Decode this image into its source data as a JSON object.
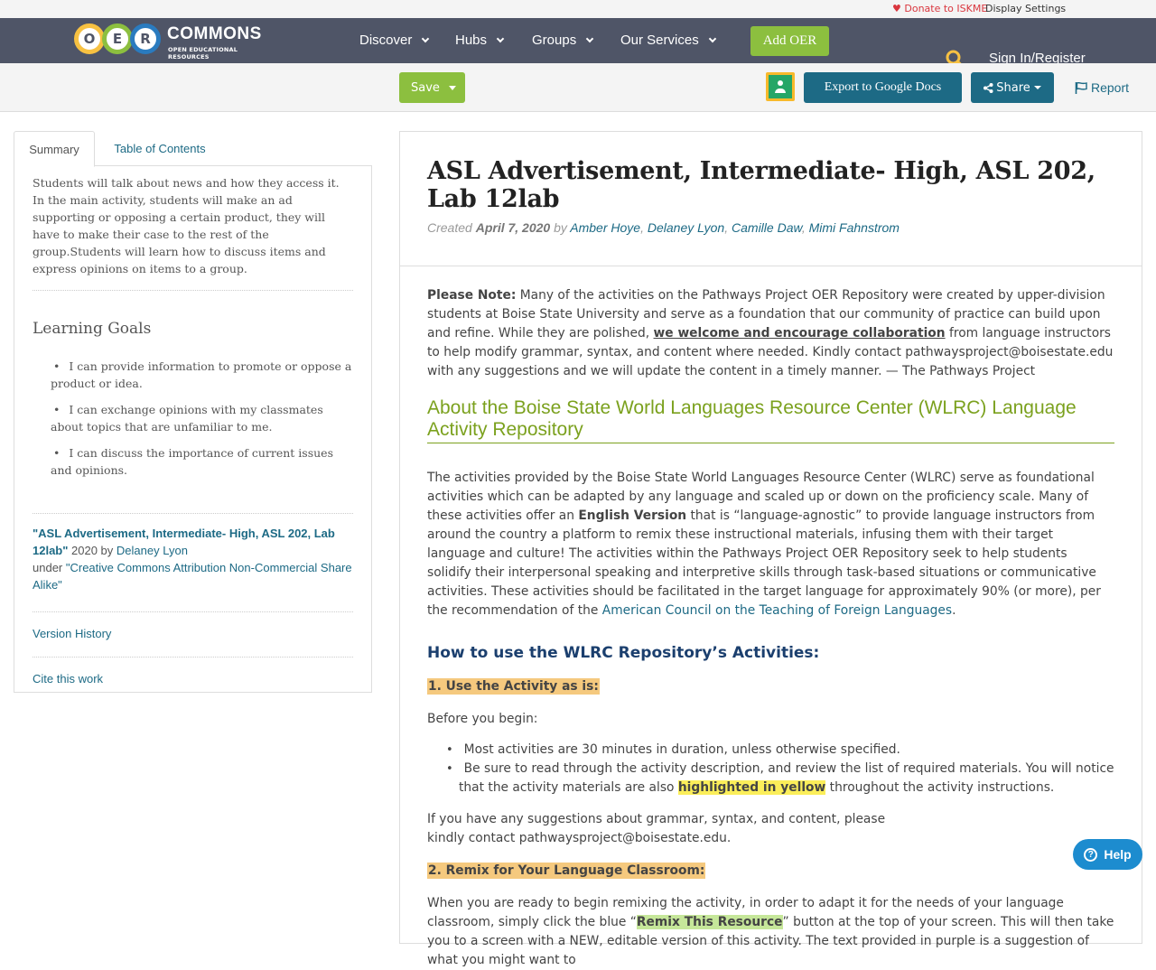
{
  "util": {
    "donate": "Donate to ISKME",
    "display": "Display Settings"
  },
  "nav": {
    "logo_letters": [
      "O",
      "E",
      "R"
    ],
    "logo_word": "COMMONS",
    "logo_sub": "OPEN EDUCATIONAL RESOURCES",
    "items": [
      "Discover",
      "Hubs",
      "Groups",
      "Our Services"
    ],
    "add_oer": "Add OER",
    "signin": "Sign In/Register"
  },
  "actions": {
    "save": "Save",
    "export": "Export to Google Docs",
    "share": "Share",
    "report": "Report"
  },
  "sidebar": {
    "tabs": [
      "Summary",
      "Table of Contents"
    ],
    "summary": "Students will talk about news and how they access it. In the main activity, students will make an ad supporting or opposing a certain product, they will have to make their case to the rest of the group.Students will learn how to discuss items and express opinions on items to a group.",
    "goals_title": "Learning Goals",
    "goals": [
      "I can provide information to promote or oppose a product or idea.",
      "I can exchange opinions with my classmates about topics that are unfamiliar to me.",
      "I can discuss the importance of current issues and opinions."
    ],
    "attrib_title": "\"ASL Advertisement, Intermediate- High, ASL 202, Lab 12lab\"",
    "attrib_year": " 2020 by ",
    "attrib_author": "Delaney Lyon",
    "attrib_under": "under ",
    "attrib_license": "\"Creative Commons Attribution Non-Commercial Share Alike\"",
    "version_history": "Version History",
    "cite": "Cite this work"
  },
  "main": {
    "title": "ASL Advertisement, Intermediate- High, ASL 202, Lab 12lab",
    "created_label": "Created",
    "created_date": "April 7, 2020",
    "by": "by",
    "authors": [
      "Amber Hoye",
      "Delaney Lyon",
      "Camille Daw",
      "Mimi Fahnstrom"
    ],
    "note_label": "Please Note:",
    "note_text1": " Many of the activities on the Pathways Project OER Repository were created by upper-division students at Boise State University and serve as a foundation that our community of practice can build upon and refine. While they are polished, ",
    "note_link": "we welcome and encourage collaboration",
    "note_text2": " from language instructors to help modify grammar, syntax, and content where needed. Kindly contact pathwaysproject@boisestate.edu with any suggestions and we will update the content in a timely manner.  — The Pathways Project",
    "about_heading": "About the Boise State World Languages Resource Center (WLRC) Language Activity Repository",
    "about_p1": "The activities provided by the Boise State World Languages Resource Center (WLRC) serve as foundational activities which can be adapted by any language and scaled up or down on the proficiency scale. Many of these activities offer an ",
    "about_bold": "English Version",
    "about_p2": " that is “language-agnostic” to provide language instructors from around the country a platform to remix these instructional materials, infusing them with their target language and culture! The activities within the Pathways Project OER Repository seek to help students solidify their interpersonal speaking and interpretive skills through task-based situations or communicative activities. These activities should be facilitated in the target language for approximately 90% (or more), per the recommendation of the ",
    "about_link": "American Council on the Teaching of Foreign Languages",
    "about_end": ".",
    "howto_heading": "How to use the WLRC Repository’s Activities:",
    "step1": "1. Use the Activity as is:",
    "before": "Before you begin:",
    "bullet1": "Most activities are 30 minutes in duration, unless otherwise specified.",
    "bullet2a": "Be sure to read through the activity description, and review the list of required materials. You will notice that the activity materials are also ",
    "bullet2_hl": "highlighted in yellow",
    "bullet2b": " throughout the activity instructions.",
    "suggest": "If you have any suggestions about grammar, syntax, and content, please kindly contact pathwaysproject@boisestate.edu.",
    "step2": "2. Remix for Your Language Classroom:",
    "remix_a": "When you are ready to begin remixing the activity, in order to adapt it for the needs of your language classroom, simply click the blue “",
    "remix_hl": "Remix This Resource",
    "remix_b": "” button at the top of your screen. This will then take you to a screen with a NEW, editable version of this activity. The text provided in purple is a suggestion of what you might want to"
  },
  "help": "Help",
  "colors": {
    "nav": "#4f5567",
    "green": "#8cbf3f",
    "teal": "#1d6a85",
    "heading_green": "#7ba11e",
    "navy": "#1b3f6e"
  }
}
